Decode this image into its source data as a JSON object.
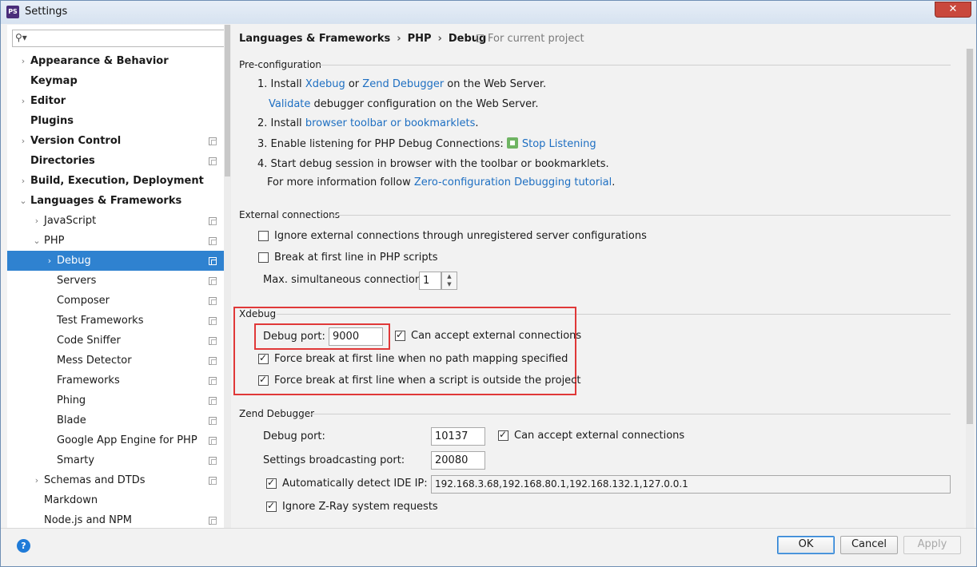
{
  "window": {
    "title": "Settings",
    "app_badge": "PS",
    "close_glyph": "✕"
  },
  "search": {
    "placeholder": "",
    "icon": "search-icon"
  },
  "tree": [
    {
      "label": "Appearance & Behavior",
      "arrow": "›",
      "bold": true,
      "indent": 0,
      "copy": false
    },
    {
      "label": "Keymap",
      "arrow": "",
      "bold": true,
      "indent": 0,
      "copy": false
    },
    {
      "label": "Editor",
      "arrow": "›",
      "bold": true,
      "indent": 0,
      "copy": false
    },
    {
      "label": "Plugins",
      "arrow": "",
      "bold": true,
      "indent": 0,
      "copy": false
    },
    {
      "label": "Version Control",
      "arrow": "›",
      "bold": true,
      "indent": 0,
      "copy": true
    },
    {
      "label": "Directories",
      "arrow": "",
      "bold": true,
      "indent": 0,
      "copy": true
    },
    {
      "label": "Build, Execution, Deployment",
      "arrow": "›",
      "bold": true,
      "indent": 0,
      "copy": false
    },
    {
      "label": "Languages & Frameworks",
      "arrow": "⌄",
      "bold": true,
      "indent": 0,
      "copy": false
    },
    {
      "label": "JavaScript",
      "arrow": "›",
      "bold": false,
      "indent": 1,
      "copy": true
    },
    {
      "label": "PHP",
      "arrow": "⌄",
      "bold": false,
      "indent": 1,
      "copy": true
    },
    {
      "label": "Debug",
      "arrow": "›",
      "bold": false,
      "indent": 2,
      "copy": true,
      "selected": true
    },
    {
      "label": "Servers",
      "arrow": "",
      "bold": false,
      "indent": 2,
      "copy": true
    },
    {
      "label": "Composer",
      "arrow": "",
      "bold": false,
      "indent": 2,
      "copy": true
    },
    {
      "label": "Test Frameworks",
      "arrow": "",
      "bold": false,
      "indent": 2,
      "copy": true
    },
    {
      "label": "Code Sniffer",
      "arrow": "",
      "bold": false,
      "indent": 2,
      "copy": true
    },
    {
      "label": "Mess Detector",
      "arrow": "",
      "bold": false,
      "indent": 2,
      "copy": true
    },
    {
      "label": "Frameworks",
      "arrow": "",
      "bold": false,
      "indent": 2,
      "copy": true
    },
    {
      "label": "Phing",
      "arrow": "",
      "bold": false,
      "indent": 2,
      "copy": true
    },
    {
      "label": "Blade",
      "arrow": "",
      "bold": false,
      "indent": 2,
      "copy": true
    },
    {
      "label": "Google App Engine for PHP",
      "arrow": "",
      "bold": false,
      "indent": 2,
      "copy": true
    },
    {
      "label": "Smarty",
      "arrow": "",
      "bold": false,
      "indent": 2,
      "copy": true
    },
    {
      "label": "Schemas and DTDs",
      "arrow": "›",
      "bold": false,
      "indent": 1,
      "copy": true
    },
    {
      "label": "Markdown",
      "arrow": "",
      "bold": false,
      "indent": 1,
      "copy": false
    },
    {
      "label": "Node.js and NPM",
      "arrow": "",
      "bold": false,
      "indent": 1,
      "copy": true
    }
  ],
  "breadcrumb": [
    "Languages & Frameworks",
    "PHP",
    "Debug"
  ],
  "breadcrumb_sep": "›",
  "for_project": "For current project",
  "preconfig": {
    "title": "Pre-configuration",
    "step1_prefix": "1. Install ",
    "step1_link1": "Xdebug",
    "step1_or": " or ",
    "step1_link2": "Zend Debugger",
    "step1_suffix": " on the Web Server.",
    "step1b_link": "Validate",
    "step1b_suffix": " debugger configuration on the Web Server.",
    "step2_prefix": "2. Install ",
    "step2_link": "browser toolbar or bookmarklets",
    "step2_suffix": ".",
    "step3_prefix": "3. Enable listening for PHP Debug Connections: ",
    "step3_link": "Stop Listening",
    "step4": "4. Start debug session in browser with the toolbar or bookmarklets.",
    "step4b_prefix": "For more information follow ",
    "step4b_link": "Zero-configuration Debugging tutorial",
    "step4b_suffix": "."
  },
  "external": {
    "title": "External connections",
    "ignore_label": "Ignore external connections through unregistered server configurations",
    "ignore_checked": false,
    "break_label": "Break at first line in PHP scripts",
    "break_checked": false,
    "max_label": "Max. simultaneous connections:",
    "max_value": "1"
  },
  "xdebug": {
    "title": "Xdebug",
    "port_label": "Debug port:",
    "port_value": "9000",
    "accept_label": "Can accept external connections",
    "accept_checked": true,
    "force_mapping_label": "Force break at first line when no path mapping specified",
    "force_mapping_checked": true,
    "force_outside_label": "Force break at first line when a script is outside the project",
    "force_outside_checked": true
  },
  "zend": {
    "title": "Zend Debugger",
    "port_label": "Debug port:",
    "port_value": "10137",
    "accept_label": "Can accept external connections",
    "accept_checked": true,
    "broadcast_label": "Settings broadcasting port:",
    "broadcast_value": "20080",
    "detect_label": "Automatically detect IDE IP:",
    "detect_checked": true,
    "detect_value": "192.168.3.68,192.168.80.1,192.168.132.1,127.0.0.1",
    "ignore_zray_label": "Ignore Z-Ray system requests",
    "ignore_zray_checked": true
  },
  "footer": {
    "help": "?",
    "ok": "OK",
    "cancel": "Cancel",
    "apply": "Apply"
  },
  "colors": {
    "selection": "#2f82d0",
    "link": "#1e6fc2",
    "highlight_box": "#e03838"
  }
}
